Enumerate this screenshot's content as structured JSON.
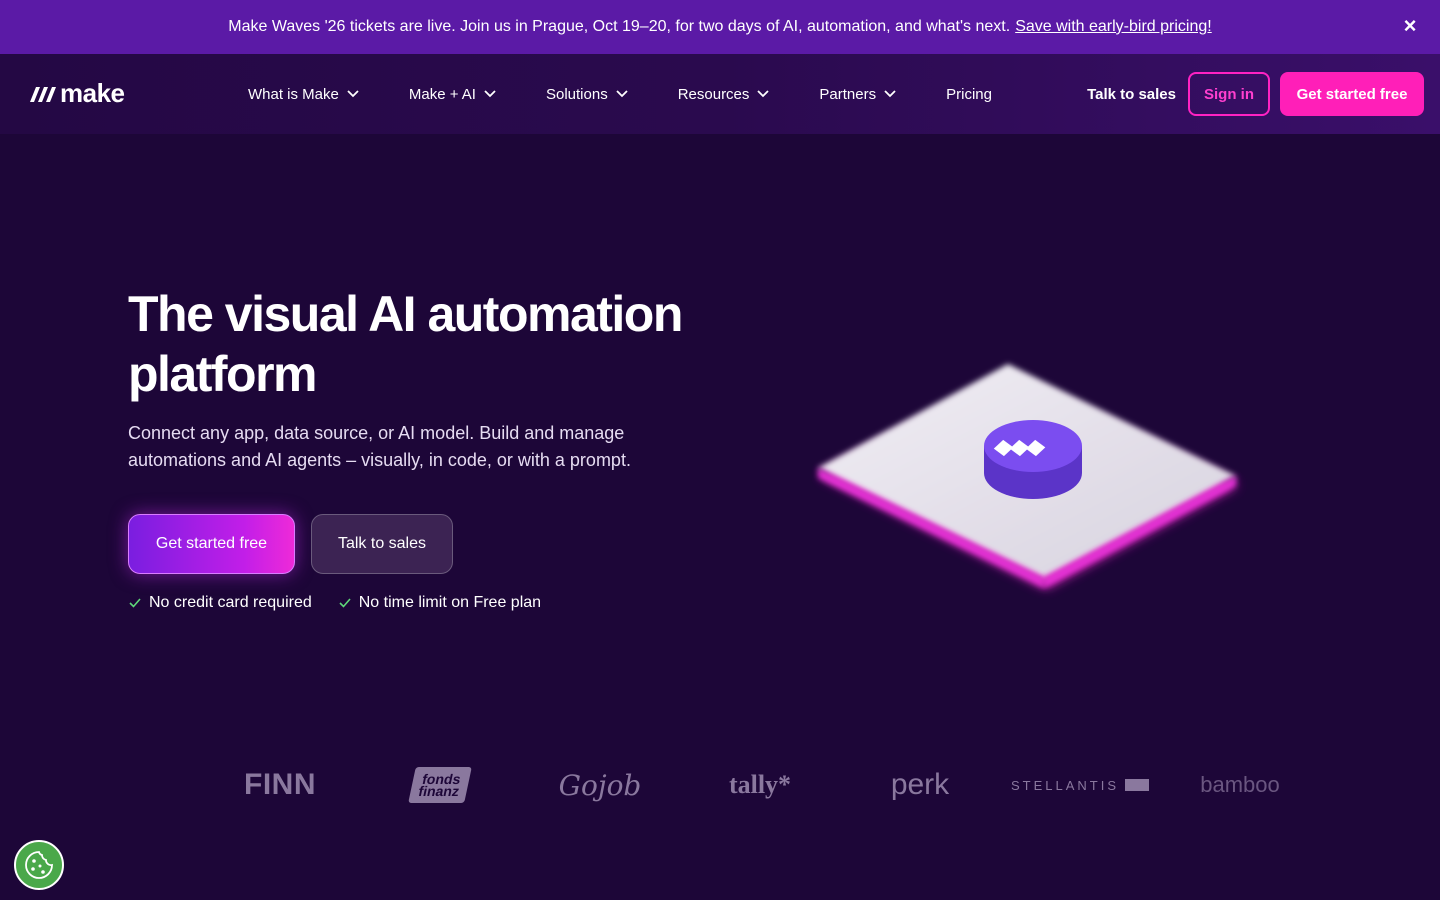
{
  "banner": {
    "text": "Make Waves '26 tickets are live. Join us in Prague, Oct 19–20, for two days of AI, automation, and what's next.",
    "link": "Save with early-bird pricing!",
    "close_icon": "close-icon"
  },
  "nav": {
    "logo_text": "make",
    "items": [
      {
        "label": "What is Make"
      },
      {
        "label": "Make + AI"
      },
      {
        "label": "Solutions"
      },
      {
        "label": "Resources"
      },
      {
        "label": "Partners"
      },
      {
        "label": "Pricing"
      }
    ],
    "talk_to_sales": "Talk to sales",
    "sign_in": "Sign in",
    "get_started": "Get started free"
  },
  "hero": {
    "title": "The visual AI automation platform",
    "subtitle": "Connect any app, data source, or AI model. Build and manage automations and AI agents – visually, in code, or with a prompt.",
    "primary_button": "Get started free",
    "secondary_button": "Talk to sales",
    "checks": [
      "No credit card required",
      "No time limit on Free plan"
    ]
  },
  "logos": {
    "finn": "FINN",
    "fonds_line1": "fonds",
    "fonds_line2": "finanz",
    "gojob": "Gojob",
    "tally": "tally*",
    "perk": "perk",
    "stellantis": "STELLANTIS",
    "bamboo": "bamboo"
  },
  "colors": {
    "background": "#1d0638",
    "banner": "#5b1aa6",
    "accent_pink": "#ff1fb8",
    "accent_purple": "#7a1ee0"
  },
  "icons": {
    "cookie": "cookie-icon",
    "chevron": "chevron-down-icon",
    "check": "check-icon"
  }
}
